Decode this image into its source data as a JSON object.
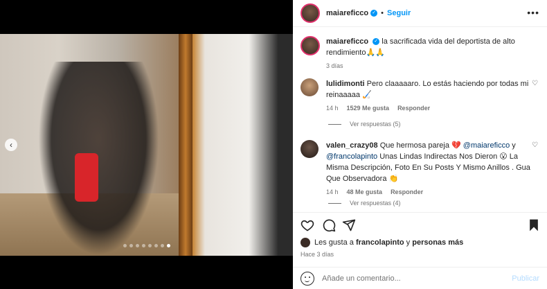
{
  "post": {
    "username": "maiareficco",
    "follow_label": "Seguir",
    "separator": "•",
    "more_icon": "more-horizontal-icon",
    "caption": "la sacrificada vida del deportista de alto rendimiento🙏🙏",
    "caption_time": "3 días"
  },
  "media": {
    "prev_icon": "chevron-left-icon",
    "dots_count": 8,
    "active_dot": 7
  },
  "comments": [
    {
      "user": "lulidimonti",
      "text": "Pero claaaaaro. Lo estás haciendo por todas mi reinaaaaa 🏑",
      "time": "14 h",
      "likes": "1529 Me gusta",
      "reply": "Responder",
      "view_replies": "Ver respuestas (5)"
    },
    {
      "user": "valen_crazy08",
      "text_before": "Que hermosa pareja 💔",
      "mention1": "@maiareficco",
      "text_mid": " y ",
      "mention2": "@francolapinto",
      "text_after": " Unas Lindas Indirectas Nos Dieron 😮 La Misma Descripción, Foto En Su Posts Y Mismo Anillos . Gua Que Observadora 👏",
      "time": "14 h",
      "likes": "48 Me gusta",
      "reply": "Responder",
      "view_replies": "Ver respuestas (4)"
    }
  ],
  "likes_line": {
    "prefix": "Les gusta a ",
    "user": "francolapinto",
    "connector": " y ",
    "rest": "personas más"
  },
  "posted_ago": "Hace 3 días",
  "add_comment": {
    "placeholder": "Añade un comentario...",
    "publish_label": "Publicar"
  },
  "colors": {
    "link_blue": "#0095f6",
    "mention": "#00376b",
    "publish_disabled": "#b3dbff",
    "story_ring": "#e1306c"
  }
}
